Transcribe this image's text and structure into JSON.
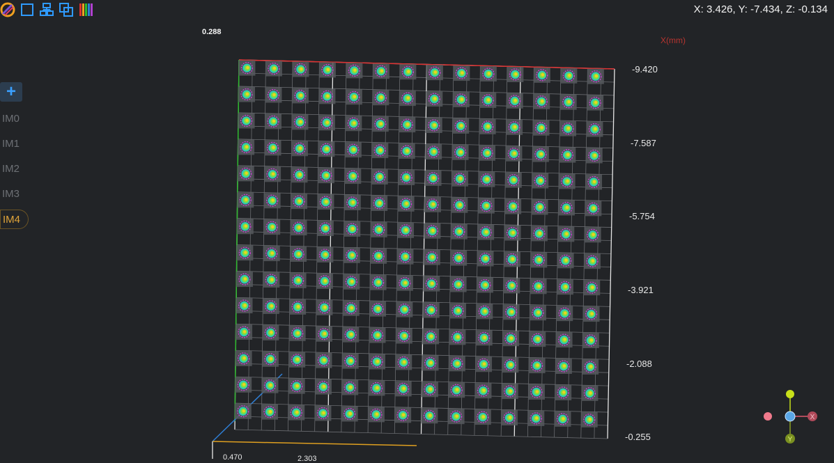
{
  "toolbar": {
    "items": [
      {
        "icon": "logo-icon"
      },
      {
        "icon": "square-select-icon"
      },
      {
        "icon": "align-icon"
      },
      {
        "icon": "copy-layers-icon"
      },
      {
        "icon": "color-bars-icon"
      }
    ]
  },
  "cursor_readout": "X: 3.426, Y: -7.434, Z: -0.134",
  "top_small_label": "0.288",
  "axis_unit_label": "X(mm)",
  "sidebar": {
    "add_label": "+",
    "images": [
      "IM0",
      "IM1",
      "IM2",
      "IM3",
      "IM4"
    ],
    "active": "IM4"
  },
  "y_ticks": [
    "-9.420",
    "-7.587",
    "-5.754",
    "-3.921",
    "-2.088",
    "-0.255"
  ],
  "x_ticks": [
    "0.470",
    "2.303"
  ],
  "grid": {
    "rows": 14,
    "cols": 14
  },
  "colors": {
    "background": "#222427",
    "accent_active": "#e0a43a",
    "x_axis": "#e03030",
    "y_axis": "#2db82d",
    "z_axis": "#2f7fd6",
    "gizmo_x": "#e05a6e",
    "gizmo_y": "#c8e01a",
    "gizmo_center": "#5aa7e6"
  },
  "gizmo_labels": {
    "x": "X",
    "y": "Y"
  }
}
